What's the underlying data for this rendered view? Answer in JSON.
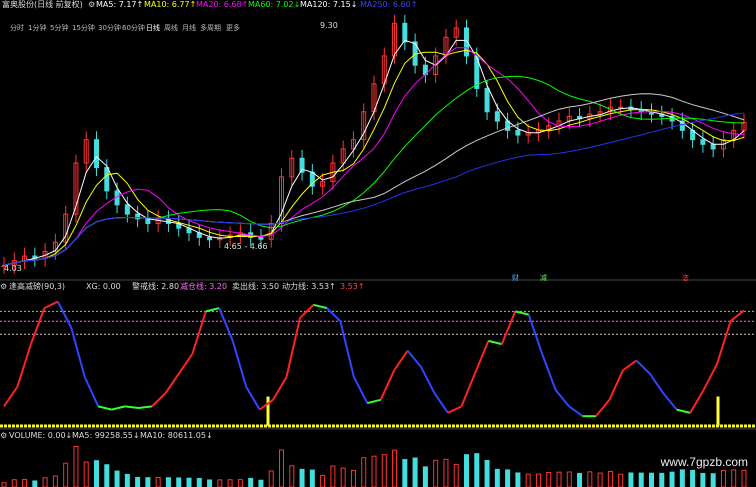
{
  "header": {
    "stock": "富奥股份(日线 前复权)",
    "ma_legend": [
      {
        "label": "MA5: 7.17↑",
        "color": "#ffffff"
      },
      {
        "label": "MA10: 6.77↑",
        "color": "#ffff00"
      },
      {
        "label": "MA20: 6.68↑",
        "color": "#ff00ff"
      },
      {
        "label": "MA60: 7.02↓",
        "color": "#00ff00"
      },
      {
        "label": "MA120: 7.15↓",
        "color": "#ffffff"
      },
      {
        "label": "MA250: 6.60↑",
        "color": "#2222ff"
      }
    ]
  },
  "periods": [
    "分时",
    "1分钟",
    "5分钟",
    "15分钟",
    "30分钟",
    "60分钟",
    "日线",
    "周线",
    "月线",
    "多周期",
    "更多"
  ],
  "active_period": "日线",
  "price_annotations": {
    "high": "9.30",
    "range": "4.65 - 4.66",
    "low": "4.03"
  },
  "markers": {
    "cai": "财",
    "jian": "减",
    "xi": "恣"
  },
  "indicator": {
    "items": [
      {
        "label": "逢高减磅(90,3)",
        "color": "#dddddd"
      },
      {
        "label": "XG: 0.00",
        "color": "#dddddd"
      },
      {
        "label": "警戒线: 2.80",
        "color": "#dddddd"
      },
      {
        "label": "减仓线: 3.20",
        "color": "#ff66ff"
      },
      {
        "label": "卖出线: 3.50",
        "color": "#dddddd"
      },
      {
        "label": "动力线: 3.53↑",
        "color": "#dddddd"
      },
      {
        "label": "3.53↑",
        "color": "#ff4444"
      }
    ]
  },
  "volume": {
    "items": [
      {
        "label": "VOLUME: 0.00↓",
        "color": "#dddddd"
      },
      {
        "label": "MA5: 99258.55↓",
        "color": "#dddddd"
      },
      {
        "label": "MA10: 80611.05↓",
        "color": "#dddddd"
      }
    ]
  },
  "watermark": "www.7gpzb.com",
  "chart_data": {
    "type": "line",
    "title": "富奥股份 日线",
    "price_series": {
      "name": "close",
      "values": [
        4.1,
        4.2,
        4.3,
        4.25,
        4.4,
        4.6,
        5.2,
        6.3,
        6.8,
        6.2,
        5.7,
        5.4,
        5.2,
        5.1,
        5.0,
        5.1,
        5.0,
        4.9,
        4.8,
        4.7,
        4.65,
        4.7,
        4.75,
        4.8,
        4.7,
        4.66,
        5.0,
        6.0,
        6.4,
        6.1,
        5.8,
        5.9,
        6.3,
        6.6,
        6.8,
        7.4,
        8.0,
        8.6,
        9.3,
        8.9,
        8.4,
        8.2,
        8.6,
        9.0,
        9.2,
        8.6,
        7.9,
        7.4,
        7.2,
        7.0,
        6.9,
        6.95,
        7.0,
        7.1,
        7.2,
        7.3,
        7.25,
        7.35,
        7.4,
        7.5,
        7.5,
        7.45,
        7.4,
        7.35,
        7.3,
        7.2,
        7.0,
        6.8,
        6.7,
        6.6,
        6.8,
        7.0,
        7.17
      ]
    },
    "indicator_series": {
      "name": "动力线",
      "values": [
        0.6,
        1.2,
        2.5,
        3.6,
        3.8,
        3.0,
        1.5,
        0.6,
        0.5,
        0.6,
        0.55,
        0.6,
        1.0,
        1.6,
        2.2,
        3.5,
        3.6,
        2.6,
        1.2,
        0.5,
        0.8,
        1.5,
        3.3,
        3.7,
        3.6,
        3.2,
        1.5,
        0.7,
        0.8,
        1.7,
        2.3,
        1.8,
        1.0,
        0.4,
        0.6,
        1.6,
        2.6,
        2.5,
        3.5,
        3.4,
        2.2,
        1.1,
        0.6,
        0.3,
        0.3,
        0.8,
        1.7,
        2.0,
        1.6,
        1.0,
        0.5,
        0.4,
        1.1,
        1.9,
        3.2,
        3.53
      ]
    },
    "thresholds": {
      "警戒线": 2.8,
      "减仓线": 3.2,
      "卖出线": 3.5
    },
    "ylim_price": [
      4.0,
      9.5
    ],
    "ylim_indicator": [
      0,
      4.0
    ],
    "grid": false
  }
}
